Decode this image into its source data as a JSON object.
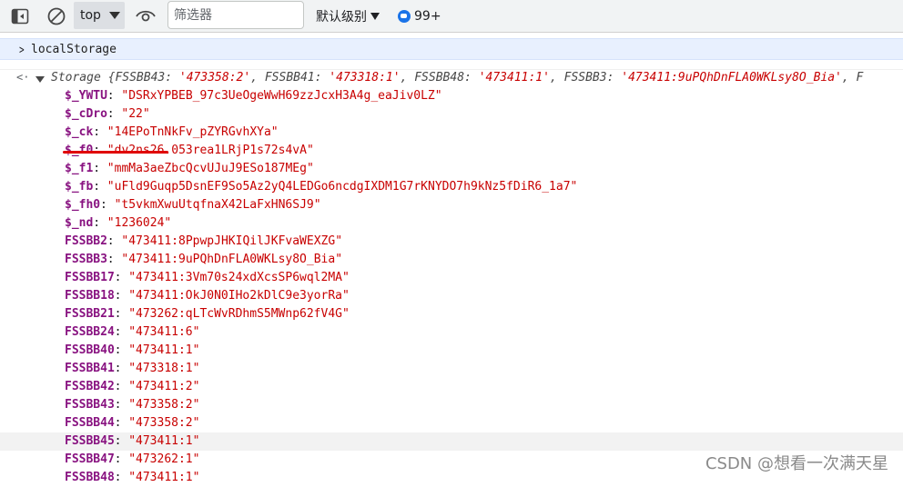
{
  "toolbar": {
    "context": "top",
    "filter_placeholder": "筛选器",
    "level": "默认级别",
    "issues_count": "99+"
  },
  "console": {
    "command": "localStorage",
    "storage_summary": {
      "prefix": "Storage {",
      "pairs": [
        {
          "key": "FSSBB43",
          "value": "'473358:2'"
        },
        {
          "key": "FSSBB41",
          "value": "'473318:1'"
        },
        {
          "key": "FSSBB48",
          "value": "'473411:1'"
        },
        {
          "key": "FSSBB3",
          "value": "'473411:9uPQhDnFLA0WKLsy8O_Bia'"
        }
      ],
      "tail": ", F"
    },
    "properties": [
      {
        "key": "$_YWTU",
        "value": "\"DSRxYPBEB_97c3UeOgeWwH69zzJcxH3A4g_eaJiv0LZ\""
      },
      {
        "key": "$_cDro",
        "value": "\"22\""
      },
      {
        "key": "$_ck",
        "value": "\"14EPoTnNkFv_pZYRGvhXYa\""
      },
      {
        "key": "$_f0",
        "value": "\"dv2ns26.053rea1LRjP1s72s4vA\""
      },
      {
        "key": "$_f1",
        "value": "\"mmMa3aeZbcQcvUJuJ9ESo187MEg\""
      },
      {
        "key": "$_fb",
        "value": "\"uFld9Guqp5DsnEF9So5Az2yQ4LEDGo6ncdgIXDM1G7rKNYDO7h9kNz5fDiR6_1a7\""
      },
      {
        "key": "$_fh0",
        "value": "\"t5vkmXwuUtqfnaX42LaFxHN6SJ9\""
      },
      {
        "key": "$_nd",
        "value": "\"1236024\""
      },
      {
        "key": "FSSBB2",
        "value": "\"473411:8PpwpJHKIQilJKFvaWEXZG\""
      },
      {
        "key": "FSSBB3",
        "value": "\"473411:9uPQhDnFLA0WKLsy8O_Bia\""
      },
      {
        "key": "FSSBB17",
        "value": "\"473411:3Vm70s24xdXcsSP6wql2MA\""
      },
      {
        "key": "FSSBB18",
        "value": "\"473411:OkJ0N0IHo2kDlC9e3yorRa\""
      },
      {
        "key": "FSSBB21",
        "value": "\"473262:qLTcWvRDhmS5MWnp62fV4G\""
      },
      {
        "key": "FSSBB24",
        "value": "\"473411:6\""
      },
      {
        "key": "FSSBB40",
        "value": "\"473411:1\""
      },
      {
        "key": "FSSBB41",
        "value": "\"473318:1\""
      },
      {
        "key": "FSSBB42",
        "value": "\"473411:2\""
      },
      {
        "key": "FSSBB43",
        "value": "\"473358:2\""
      },
      {
        "key": "FSSBB44",
        "value": "\"473358:2\""
      },
      {
        "key": "FSSBB45",
        "value": "\"473411:1\""
      },
      {
        "key": "FSSBB47",
        "value": "\"473262:1\""
      },
      {
        "key": "FSSBB48",
        "value": "\"473411:1\""
      }
    ]
  },
  "watermark": "CSDN @想看一次满天星"
}
